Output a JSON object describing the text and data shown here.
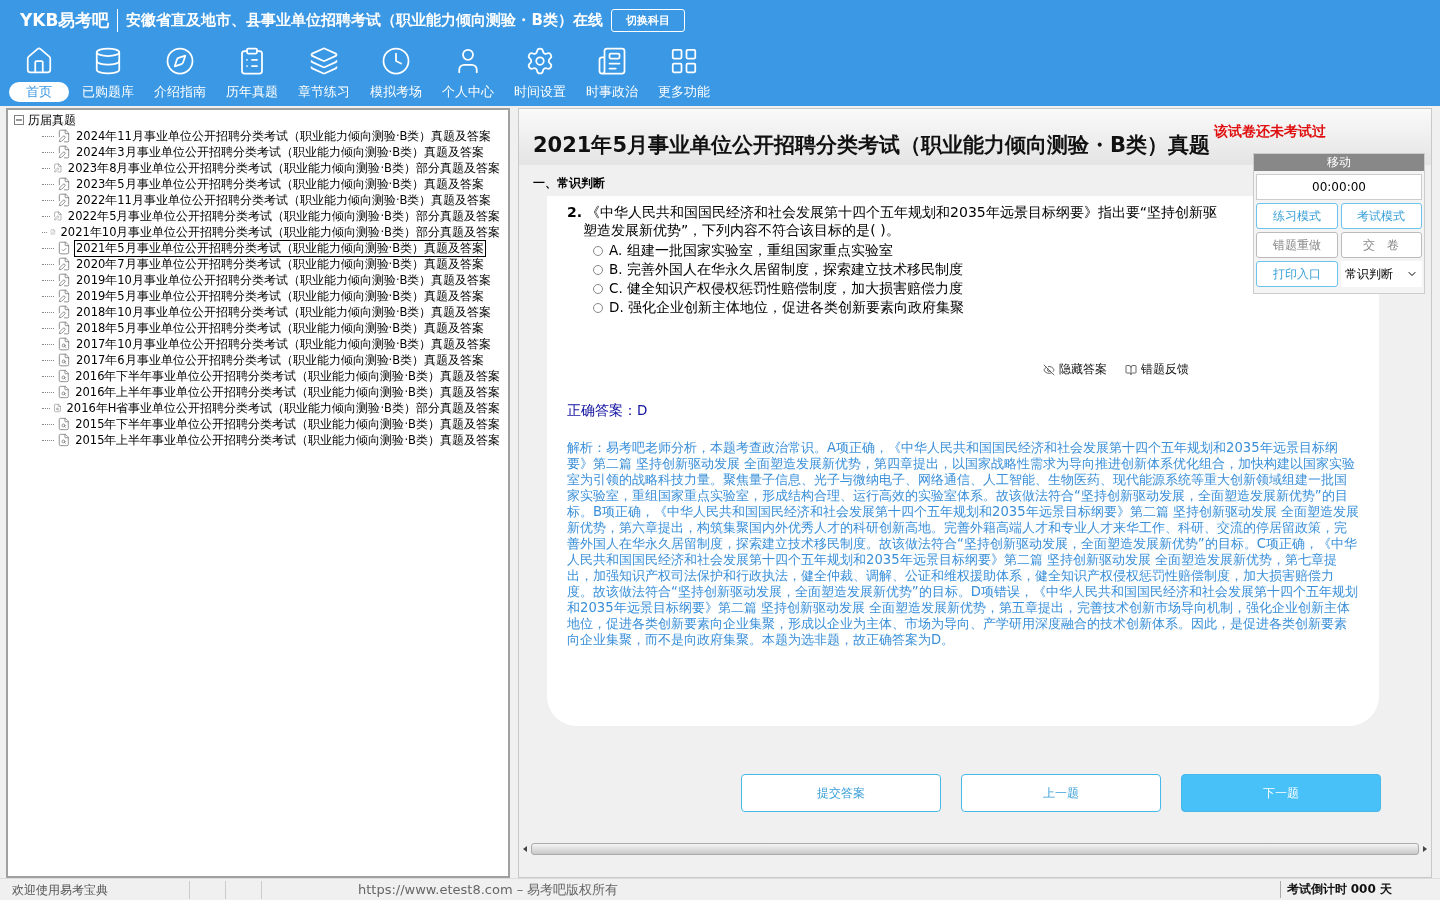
{
  "header": {
    "logo": "YKB易考吧",
    "title": "安徽省直及地市、县事业单位招聘考试（职业能力倾向测验・B类）在线",
    "switch_button": "切换科目"
  },
  "nav": [
    {
      "label": "首页",
      "selected": true
    },
    {
      "label": "已购题库",
      "selected": false
    },
    {
      "label": "介绍指南",
      "selected": false
    },
    {
      "label": "历年真题",
      "selected": false
    },
    {
      "label": "章节练习",
      "selected": false
    },
    {
      "label": "模拟考场",
      "selected": false
    },
    {
      "label": "个人中心",
      "selected": false
    },
    {
      "label": "时间设置",
      "selected": false
    },
    {
      "label": "时事政治",
      "selected": false
    },
    {
      "label": "更多功能",
      "selected": false
    }
  ],
  "tree": {
    "root": {
      "label": "历届真题",
      "expanded": true,
      "children": [
        {
          "label": "2024年11月事业单位公开招聘分类考试（职业能力倾向测验·B类）真题及答案",
          "kind": "edit",
          "selected": false
        },
        {
          "label": "2024年3月事业单位公开招聘分类考试（职业能力倾向测验·B类）真题及答案",
          "kind": "edit",
          "selected": false
        },
        {
          "label": "2023年8月事业单位公开招聘分类考试（职业能力倾向测验·B类）部分真题及答案",
          "kind": "edit",
          "selected": false
        },
        {
          "label": "2023年5月事业单位公开招聘分类考试（职业能力倾向测验·B类）真题及答案",
          "kind": "edit",
          "selected": false
        },
        {
          "label": "2022年11月事业单位公开招聘分类考试（职业能力倾向测验·B类）真题及答案",
          "kind": "edit",
          "selected": false
        },
        {
          "label": "2022年5月事业单位公开招聘分类考试（职业能力倾向测验·B类）部分真题及答案",
          "kind": "edit",
          "selected": false
        },
        {
          "label": "2021年10月事业单位公开招聘分类考试（职业能力倾向测验·B类）部分真题及答案",
          "kind": "edit",
          "selected": false
        },
        {
          "label": "2021年5月事业单位公开招聘分类考试（职业能力倾向测验·B类）真题及答案",
          "kind": "current",
          "selected": true
        },
        {
          "label": "2020年7月事业单位公开招聘分类考试（职业能力倾向测验·B类）真题及答案",
          "kind": "edit",
          "selected": false
        },
        {
          "label": "2019年10月事业单位公开招聘分类考试（职业能力倾向测验·B类）真题及答案",
          "kind": "edit",
          "selected": false
        },
        {
          "label": "2019年5月事业单位公开招聘分类考试（职业能力倾向测验·B类）真题及答案",
          "kind": "edit",
          "selected": false
        },
        {
          "label": "2018年10月事业单位公开招聘分类考试（职业能力倾向测验·B类）真题及答案",
          "kind": "edit",
          "selected": false
        },
        {
          "label": "2018年5月事业单位公开招聘分类考试（职业能力倾向测验·B类）真题及答案",
          "kind": "edit",
          "selected": false
        },
        {
          "label": "2017年10月事业单位公开招聘分类考试（职业能力倾向测验·B类）真题及答案",
          "kind": "view",
          "selected": false
        },
        {
          "label": "2017年6月事业单位公开招聘分类考试（职业能力倾向测验·B类）真题及答案",
          "kind": "view",
          "selected": false
        },
        {
          "label": "2016年下半年事业单位公开招聘分类考试（职业能力倾向测验·B类）真题及答案",
          "kind": "view",
          "selected": false
        },
        {
          "label": "2016年上半年事业单位公开招聘分类考试（职业能力倾向测验·B类）真题及答案",
          "kind": "view",
          "selected": false
        },
        {
          "label": "2016年H省事业单位公开招聘分类考试（职业能力倾向测验·B类）部分真题及答案",
          "kind": "view",
          "selected": false
        },
        {
          "label": "2015年下半年事业单位公开招聘分类考试（职业能力倾向测验·B类）真题及答案",
          "kind": "view",
          "selected": false
        },
        {
          "label": "2015年上半年事业单位公开招聘分类考试（职业能力倾向测验·B类）真题及答案",
          "kind": "view",
          "selected": false
        }
      ]
    }
  },
  "exam": {
    "title": "2021年5月事业单位公开招聘分类考试（职业能力倾向测验・B类）真题",
    "status_note": "该试卷还未考试过",
    "section": "一、常识判断",
    "question": {
      "number": "2.",
      "lines": [
        "《中华人民共和国国民经济和社会发展第十四个五年规划和2035年远景目标纲要》指出要“坚持创新驱",
        "塑造发展新优势”，下列内容不符合该目标的是(  )。"
      ],
      "options": [
        {
          "label": "A. 组建一批国家实验室，重组国家重点实验室",
          "selected": false
        },
        {
          "label": "B. 完善外国人在华永久居留制度，探索建立技术移民制度",
          "selected": false
        },
        {
          "label": "C. 健全知识产权侵权惩罚性赔偿制度，加大损害赔偿力度",
          "selected": false
        },
        {
          "label": "D. 强化企业创新主体地位，促进各类创新要素向政府集聚",
          "selected": false
        }
      ]
    },
    "answer_tools": [
      "隐藏答案",
      "错题反馈"
    ],
    "correct_answer": "正确答案：D",
    "analysis": "解析：易考吧老师分析，本题考查政治常识。A项正确，《中华人民共和国国民经济和社会发展第十四个五年规划和2035年远景目标纲要》第二篇 坚持创新驱动发展 全面塑造发展新优势，第四章提出，以国家战略性需求为导向推进创新体系优化组合，加快构建以国家实验室为引领的战略科技力量。聚焦量子信息、光子与微纳电子、网络通信、人工智能、生物医药、现代能源系统等重大创新领域组建一批国家实验室，重组国家重点实验室，形成结构合理、运行高效的实验室体系。故该做法符合“坚持创新驱动发展，全面塑造发展新优势”的目标。B项正确，《中华人民共和国国民经济和社会发展第十四个五年规划和2035年远景目标纲要》第二篇 坚持创新驱动发展 全面塑造发展新优势，第六章提出，构筑集聚国内外优秀人才的科研创新高地。完善外籍高端人才和专业人才来华工作、科研、交流的停居留政策，完善外国人在华永久居留制度，探索建立技术移民制度。故该做法符合“坚持创新驱动发展，全面塑造发展新优势”的目标。C项正确，《中华人民共和国国民经济和社会发展第十四个五年规划和2035年远景目标纲要》第二篇 坚持创新驱动发展 全面塑造发展新优势，第七章提出，加强知识产权司法保护和行政执法，健全仲裁、调解、公证和维权援助体系，健全知识产权侵权惩罚性赔偿制度，加大损害赔偿力度。故该做法符合“坚持创新驱动发展，全面塑造发展新优势”的目标。D项错误，《中华人民共和国国民经济和社会发展第十四个五年规划和2035年远景目标纲要》第二篇 坚持创新驱动发展 全面塑造发展新优势，第五章提出，完善技术创新市场导向机制，强化企业创新主体地位，促进各类创新要素向企业集聚，形成以企业为主体、市场为导向、产学研用深度融合的技术创新体系。因此，是促进各类创新要素向企业集聚，而不是向政府集聚。本题为选非题，故正确答案为D。",
    "bottom_buttons": [
      {
        "label": "提交答案",
        "primary": false
      },
      {
        "label": "上一题",
        "primary": false
      },
      {
        "label": "下一题",
        "primary": true
      }
    ]
  },
  "float_panel": {
    "header": "移动",
    "timer": "00:00:00",
    "buttons": [
      {
        "label": "练习模式",
        "disabled": false
      },
      {
        "label": "考试模式",
        "disabled": false
      },
      {
        "label": "错题重做",
        "disabled": true
      },
      {
        "label": "交　卷",
        "disabled": true
      },
      {
        "label": "打印入口",
        "disabled": false
      }
    ],
    "section_select": "常识判断"
  },
  "status_bar": {
    "welcome": "欢迎使用易考宝典",
    "copyright": "https://www.etest8.com – 易考吧版权所有",
    "countdown": "考试倒计时 000 天"
  }
}
